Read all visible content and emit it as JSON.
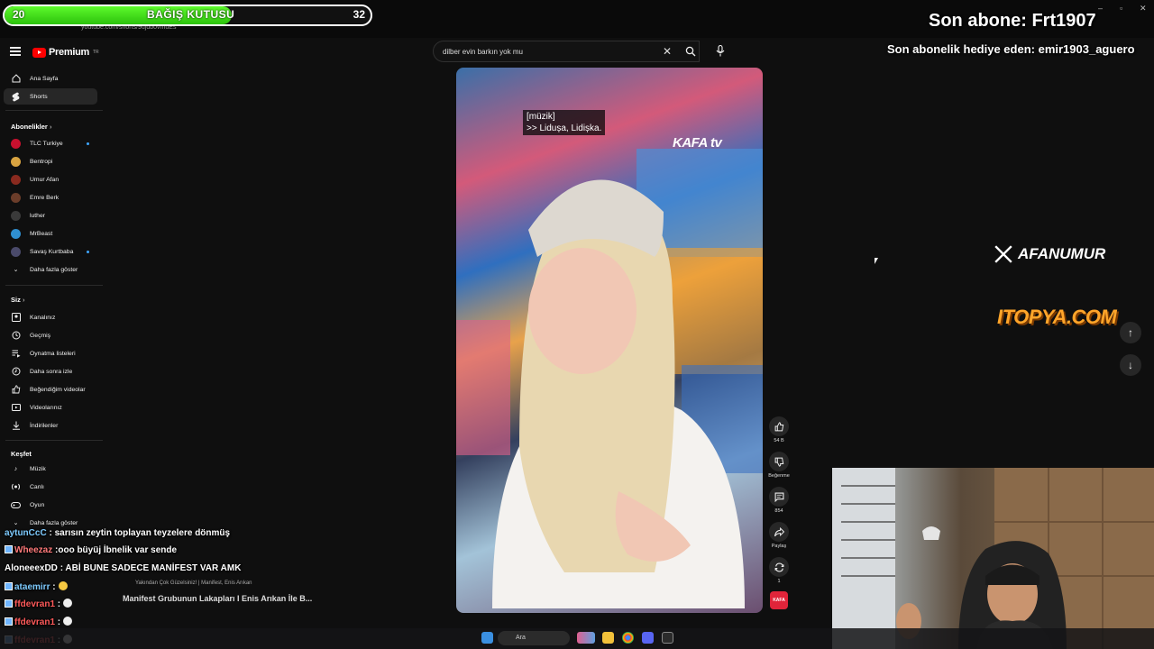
{
  "browser": {
    "url": "youtube.com/shorts/9ujdbovmuEs"
  },
  "youtube": {
    "logo_text": "Premium",
    "logo_sup": "TR",
    "search_value": "dilber evin barkın yok mu"
  },
  "sidebar": {
    "top": [
      {
        "label": "Ana Sayfa",
        "icon": "home-icon"
      },
      {
        "label": "Shorts",
        "icon": "shorts-icon"
      }
    ],
    "subscriptions_title": "Abonelikler",
    "subscriptions": [
      {
        "label": "TLC Turkiye",
        "color": "#c8102e",
        "live": true
      },
      {
        "label": "Bentropi",
        "color": "#d9a441",
        "live": false
      },
      {
        "label": "Umur Afan",
        "color": "#8a2a1f",
        "live": false
      },
      {
        "label": "Emre Berk",
        "color": "#6b3d2a",
        "live": false
      },
      {
        "label": "luther",
        "color": "#3a3a3a",
        "live": false
      },
      {
        "label": "MrBeast",
        "color": "#2f8fd0",
        "live": false
      },
      {
        "label": "Savaş Kurtbaba",
        "color": "#4a4a6a",
        "live": true
      }
    ],
    "show_more": "Daha fazla göster",
    "you_title": "Siz",
    "you_items": [
      {
        "label": "Kanalınız",
        "icon": "channel-icon"
      },
      {
        "label": "Geçmiş",
        "icon": "history-icon"
      },
      {
        "label": "Oynatma listeleri",
        "icon": "playlist-icon"
      },
      {
        "label": "Daha sonra izle",
        "icon": "clock-icon"
      },
      {
        "label": "Beğendiğim videolar",
        "icon": "like-icon"
      },
      {
        "label": "Videolarınız",
        "icon": "video-icon"
      },
      {
        "label": "İndirilenler",
        "icon": "download-icon"
      }
    ],
    "explore_title": "Keşfet",
    "explore_items": [
      {
        "label": "Müzik",
        "icon": "music-icon"
      },
      {
        "label": "Canlı",
        "icon": "live-icon"
      },
      {
        "label": "Oyun",
        "icon": "game-icon"
      }
    ],
    "explore_more": "Daha fazla göster"
  },
  "video": {
    "subtitle_line1": "[müzik]",
    "subtitle_line2": ">> Lidușa, Lidișka.",
    "watermark": "KAFA tv"
  },
  "actions": {
    "like_count": "54 B",
    "dislike_label": "Beğenme",
    "comment_count": "854",
    "share_label": "Paylaş",
    "remix_count": "1",
    "channel_badge": "KAFA"
  },
  "overlay": {
    "donation_left": "20",
    "donation_title": "BAĞIŞ KUTUSU",
    "donation_right": "32",
    "donation_progress": 0.62,
    "last_sub": "Son abone: Frt1907",
    "last_gift": "Son abonelik hediye eden: emir1903_aguero",
    "x_handle": "AFANUMUR",
    "sponsor": "ITOPYA.COM"
  },
  "chat": [
    {
      "user": "aytunCcC",
      "msg": ": sarısın zeytin toplayan teyzelere dönmüş"
    },
    {
      "user": "Wheezaz",
      "msg": ":ooo büyüj İbnelik var sende"
    },
    {
      "user": "AloneeexDD",
      "msg": ": ABİ BUNE SADECE MANİFEST VAR AMK"
    },
    {
      "user": "ataemirr",
      "msg": ":"
    },
    {
      "user": "ffdevran1",
      "msg": ":"
    },
    {
      "user": "ffdevran1",
      "msg": ":"
    },
    {
      "user": "ffdevran1",
      "msg": ":"
    }
  ],
  "suggestion": {
    "small": "Yakından Çok Güzelsiniz! | Manifest, Enis Arıkan",
    "title": "Manifest Grubunun Lakapları I Enis Arıkan İle B..."
  },
  "taskbar": {
    "search_placeholder": "Ara"
  }
}
